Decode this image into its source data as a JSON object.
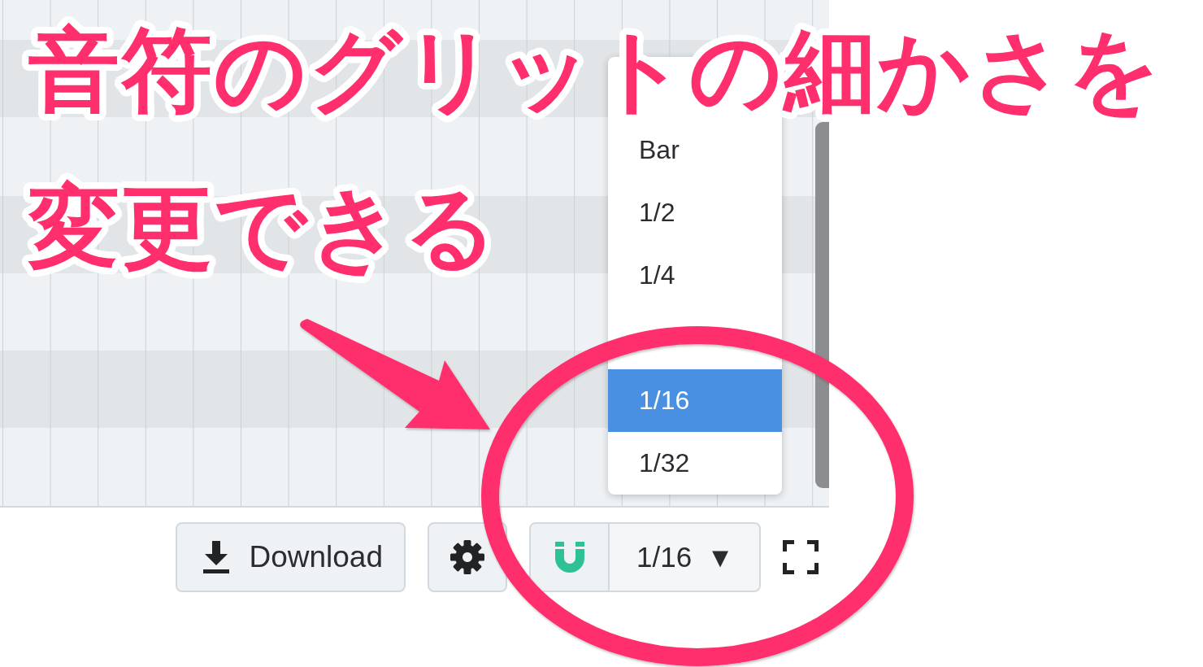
{
  "annotation": {
    "lines": [
      "音符のグリットの細かさを",
      "変更できる"
    ]
  },
  "grid_menu": {
    "items": [
      {
        "label": "Bar",
        "selected": false
      },
      {
        "label": "1/2",
        "selected": false
      },
      {
        "label": "1/4",
        "selected": false
      },
      {
        "selected": false
      },
      {
        "label": "1/16",
        "selected": true
      },
      {
        "label": "1/32",
        "selected": false
      }
    ]
  },
  "toolbar": {
    "download": {
      "label": "Download"
    },
    "snap": {
      "on": true
    },
    "grid_select": {
      "value": "1/16",
      "arrow": "▼"
    }
  }
}
